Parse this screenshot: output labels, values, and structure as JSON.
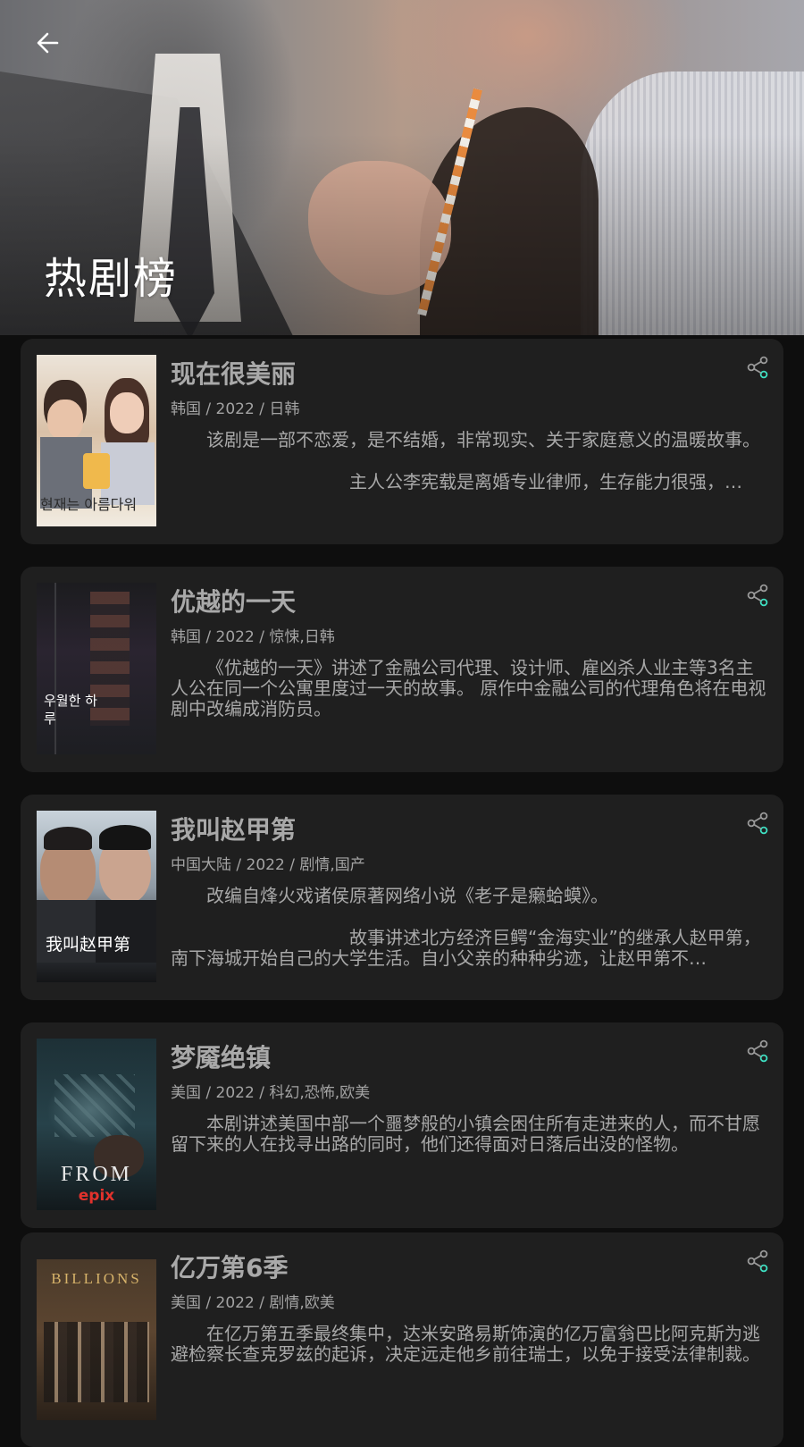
{
  "header": {
    "title": "热剧榜",
    "back_icon": "arrow-left-icon"
  },
  "colors": {
    "background": "#0e0e0e",
    "card": "#1f1f1f",
    "share_accent": "#3ee0c2"
  },
  "dramas": [
    {
      "title": "现在很美丽",
      "meta": "韩国 / 2022 / 日韩",
      "desc_p1": "该剧是一部不恋爱，是不结婚，非常现实、关于家庭意义的温暖故事。",
      "desc_p2": "主人公李宪载是离婚专业律师，生存能力很强，…",
      "poster_text": "현재는 아름다워"
    },
    {
      "title": "优越的一天",
      "meta": "韩国 / 2022 / 惊悚,日韩",
      "desc_p1": "《优越的一天》讲述了金融公司代理、设计师、雇凶杀人业主等3名主人公在同一个公寓里度过一天的故事。 原作中金融公司的代理角色将在电视剧中改编成消防员。",
      "desc_p2": "",
      "poster_text": "우월한 하루"
    },
    {
      "title": "我叫赵甲第",
      "meta": "中国大陆 / 2022 / 剧情,国产",
      "desc_p1": "改编自烽火戏诸侯原著网络小说《老子是癞蛤蟆》。",
      "desc_p2": "故事讲述北方经济巨鳄“金海实业”的继承人赵甲第，南下海城开始自己的大学生活。自小父亲的种种劣迹，让赵甲第不…",
      "poster_text": "我叫赵甲第"
    },
    {
      "title": "梦魇绝镇",
      "meta": "美国 / 2022 / 科幻,恐怖,欧美",
      "desc_p1": "本剧讲述美国中部一个噩梦般的小镇会困住所有走进来的人，而不甘愿留下来的人在找寻出路的同时，他们还得面对日落后出没的怪物。",
      "desc_p2": "",
      "poster_text": "FROM",
      "poster_sub": "epix"
    },
    {
      "title": "亿万第6季",
      "meta": "美国 / 2022 / 剧情,欧美",
      "desc_p1": "在亿万第五季最终集中，达米安路易斯饰演的亿万富翁巴比阿克斯为逃避检察长查克罗兹的起诉，决定远走他乡前往瑞士，以免于接受法律制裁。",
      "desc_p2": "",
      "poster_text": "BILLIONS"
    }
  ]
}
